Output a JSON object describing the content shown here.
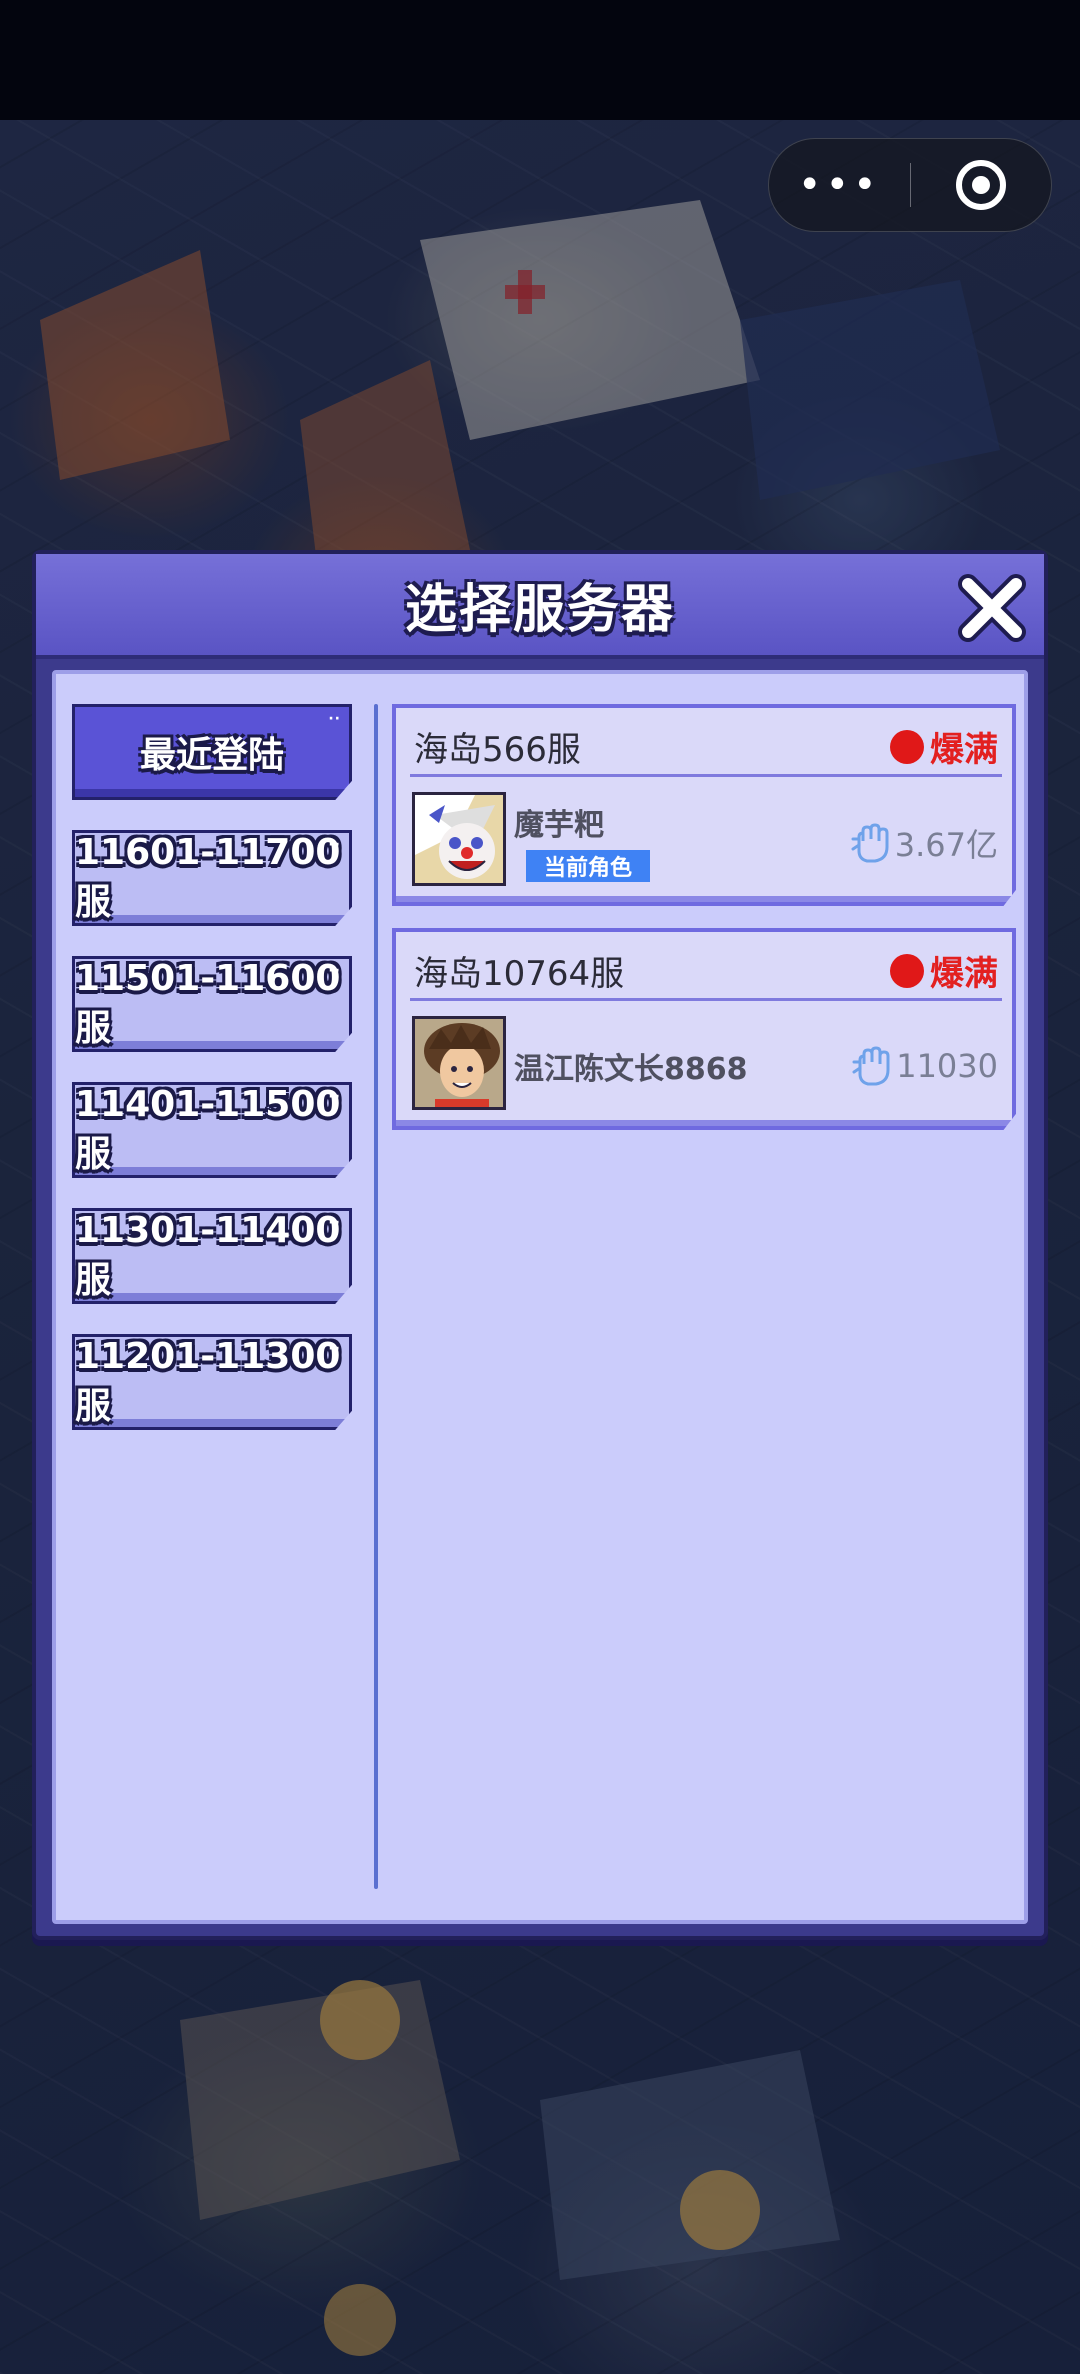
{
  "capsule": {
    "more_icon": "more-dots-icon",
    "target_icon": "target-icon"
  },
  "dialog": {
    "title": "选择服务器",
    "close_icon": "close-x-icon"
  },
  "categories": [
    {
      "label": "最近登陆",
      "active": true
    },
    {
      "label": "11601-11700服",
      "active": false
    },
    {
      "label": "11501-11600服",
      "active": false
    },
    {
      "label": "11401-11500服",
      "active": false
    },
    {
      "label": "11301-11400服",
      "active": false
    },
    {
      "label": "11201-11300服",
      "active": false
    }
  ],
  "servers": [
    {
      "name": "海岛566服",
      "status": "爆满",
      "status_color": "#e32020",
      "role": "魔芋粑",
      "badge": "当前角色",
      "power": "3.67亿",
      "avatar_icon": "clown-avatar-icon"
    },
    {
      "name": "海岛10764服",
      "status": "爆满",
      "status_color": "#e32020",
      "role": "温江陈文长8868",
      "power": "11030",
      "avatar_icon": "curly-hair-avatar-icon"
    }
  ],
  "colors": {
    "header": "#6660d0",
    "panel": "#cbccfb",
    "active_tab": "#5a53d6",
    "badge": "#3f82f4"
  }
}
